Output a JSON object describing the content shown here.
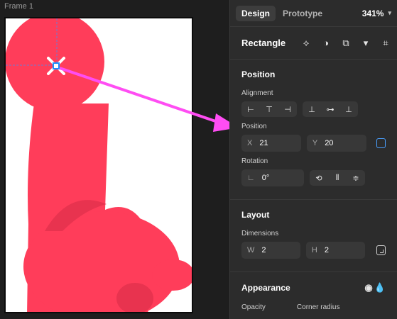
{
  "canvas": {
    "frame_label": "Frame 1",
    "colors": {
      "shape": "#ff3d5a",
      "selection": "#1e90ff",
      "arrow": "#ff4df3"
    }
  },
  "tabs": [
    {
      "label": "Design",
      "active": true
    },
    {
      "label": "Prototype",
      "active": false
    }
  ],
  "zoom": "341%",
  "layer": {
    "name": "Rectangle",
    "tools": [
      "component-icon",
      "mask-icon",
      "boolean-icon",
      "frame-icon"
    ]
  },
  "position": {
    "title": "Position",
    "alignment_label": "Alignment",
    "position_label": "Position",
    "x_label": "X",
    "x_value": "21",
    "y_label": "Y",
    "y_value": "20",
    "rotation_label": "Rotation",
    "rotation_value": "0°"
  },
  "layout": {
    "title": "Layout",
    "dimensions_label": "Dimensions",
    "w_label": "W",
    "w_value": "2",
    "h_label": "H",
    "h_value": "2"
  },
  "appearance": {
    "title": "Appearance",
    "opacity_label": "Opacity",
    "corner_radius_label": "Corner radius"
  }
}
